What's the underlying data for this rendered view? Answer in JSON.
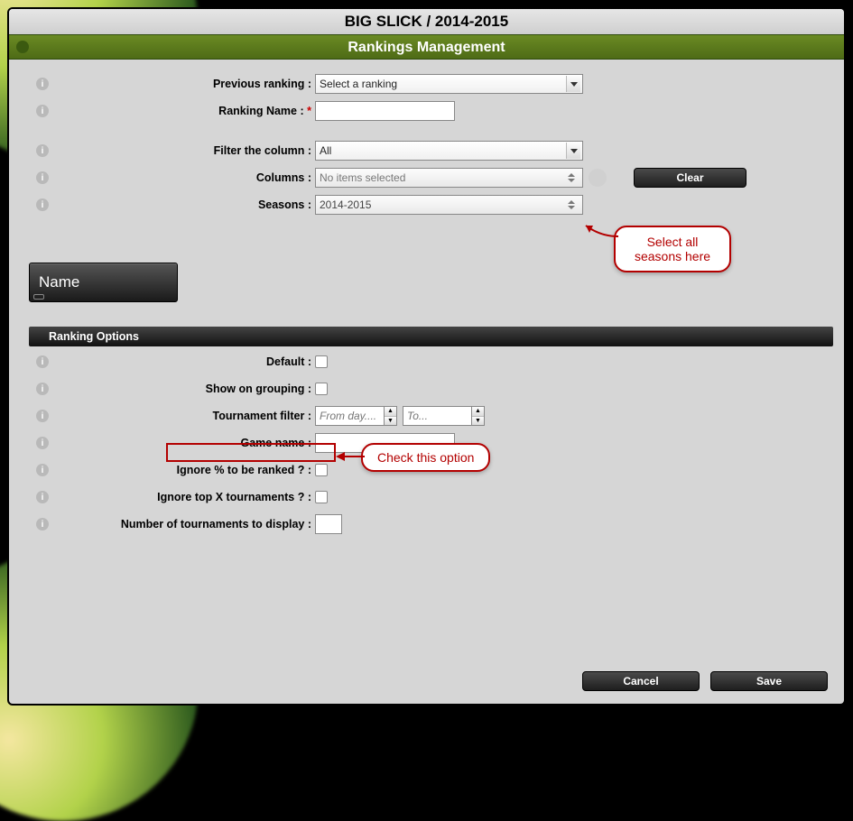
{
  "titlebar": "BIG SLICK / 2014-2015",
  "subheader": "Rankings Management",
  "form": {
    "previous_ranking": {
      "label": "Previous ranking :",
      "value": "Select a ranking"
    },
    "ranking_name": {
      "label": "Ranking Name :",
      "required": "*",
      "value": ""
    },
    "filter_column": {
      "label": "Filter the column :",
      "value": "All"
    },
    "columns": {
      "label": "Columns :",
      "value": "No items selected"
    },
    "seasons": {
      "label": "Seasons :",
      "value": "2014-2015"
    },
    "clear_btn": "Clear"
  },
  "name_pill": "Name",
  "options_header": "Ranking Options",
  "options": {
    "default": {
      "label": "Default :"
    },
    "show_grouping": {
      "label": "Show on grouping :"
    },
    "tourn_filter": {
      "label": "Tournament filter :",
      "from": "From day....",
      "to": "To..."
    },
    "game_name": {
      "label": "Game name :",
      "value": ""
    },
    "ignore_pct": {
      "label": "Ignore % to be ranked ? :"
    },
    "ignore_topx": {
      "label": "Ignore top X tournaments ? :"
    },
    "num_display": {
      "label": "Number of tournaments to display :",
      "value": ""
    }
  },
  "callouts": {
    "seasons": "Select all seasons here",
    "ignore": "Check this option"
  },
  "footer": {
    "cancel": "Cancel",
    "save": "Save"
  }
}
